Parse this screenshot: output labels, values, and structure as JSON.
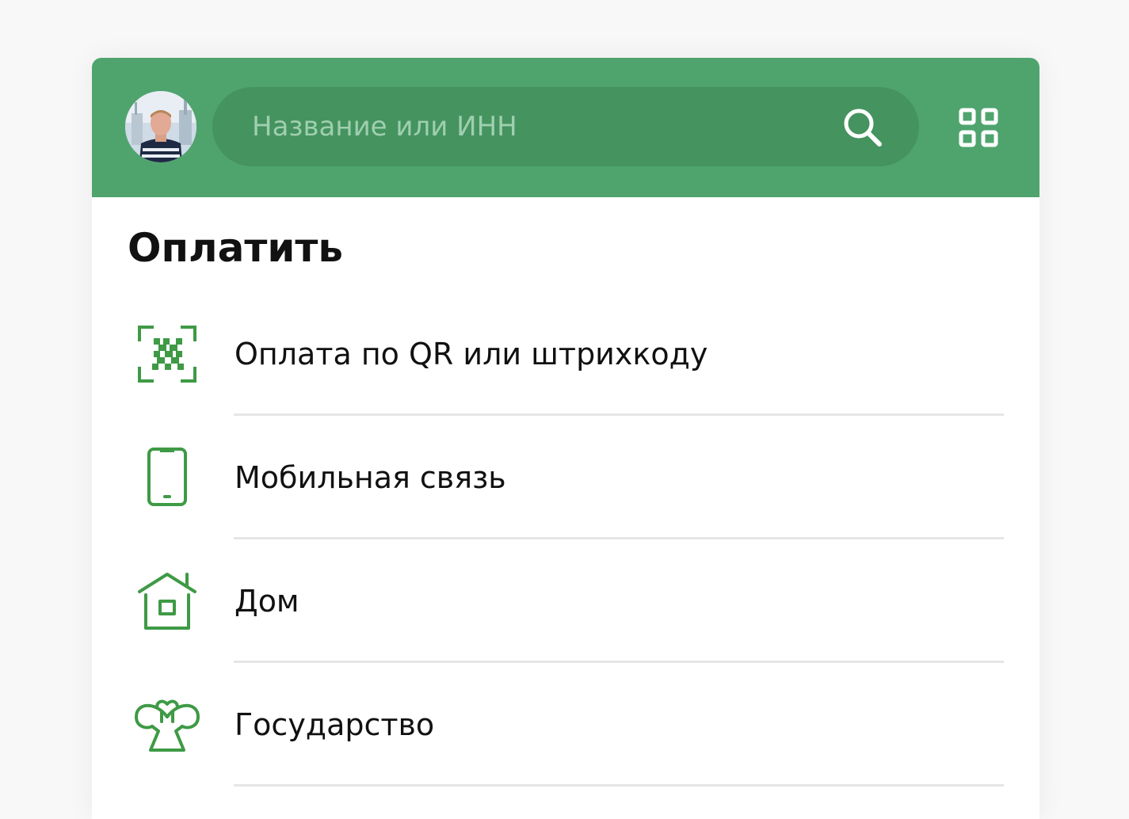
{
  "colors": {
    "header_bg": "#4fa46e",
    "search_bg": "#45935f",
    "icon_green": "#3e9a45",
    "text": "#111111",
    "divider": "#e6e6e6"
  },
  "header": {
    "avatar": "user-avatar",
    "search": {
      "placeholder": "Название или ИНН",
      "icon": "search-icon"
    },
    "grid_icon": "grid-icon"
  },
  "section": {
    "title": "Оплатить"
  },
  "items": [
    {
      "label": "Оплата по QR или штрихкоду",
      "icon": "qr-scan-icon"
    },
    {
      "label": "Мобильная связь",
      "icon": "mobile-phone-icon"
    },
    {
      "label": "Дом",
      "icon": "house-icon"
    },
    {
      "label": "Государство",
      "icon": "state-emblem-icon"
    }
  ]
}
